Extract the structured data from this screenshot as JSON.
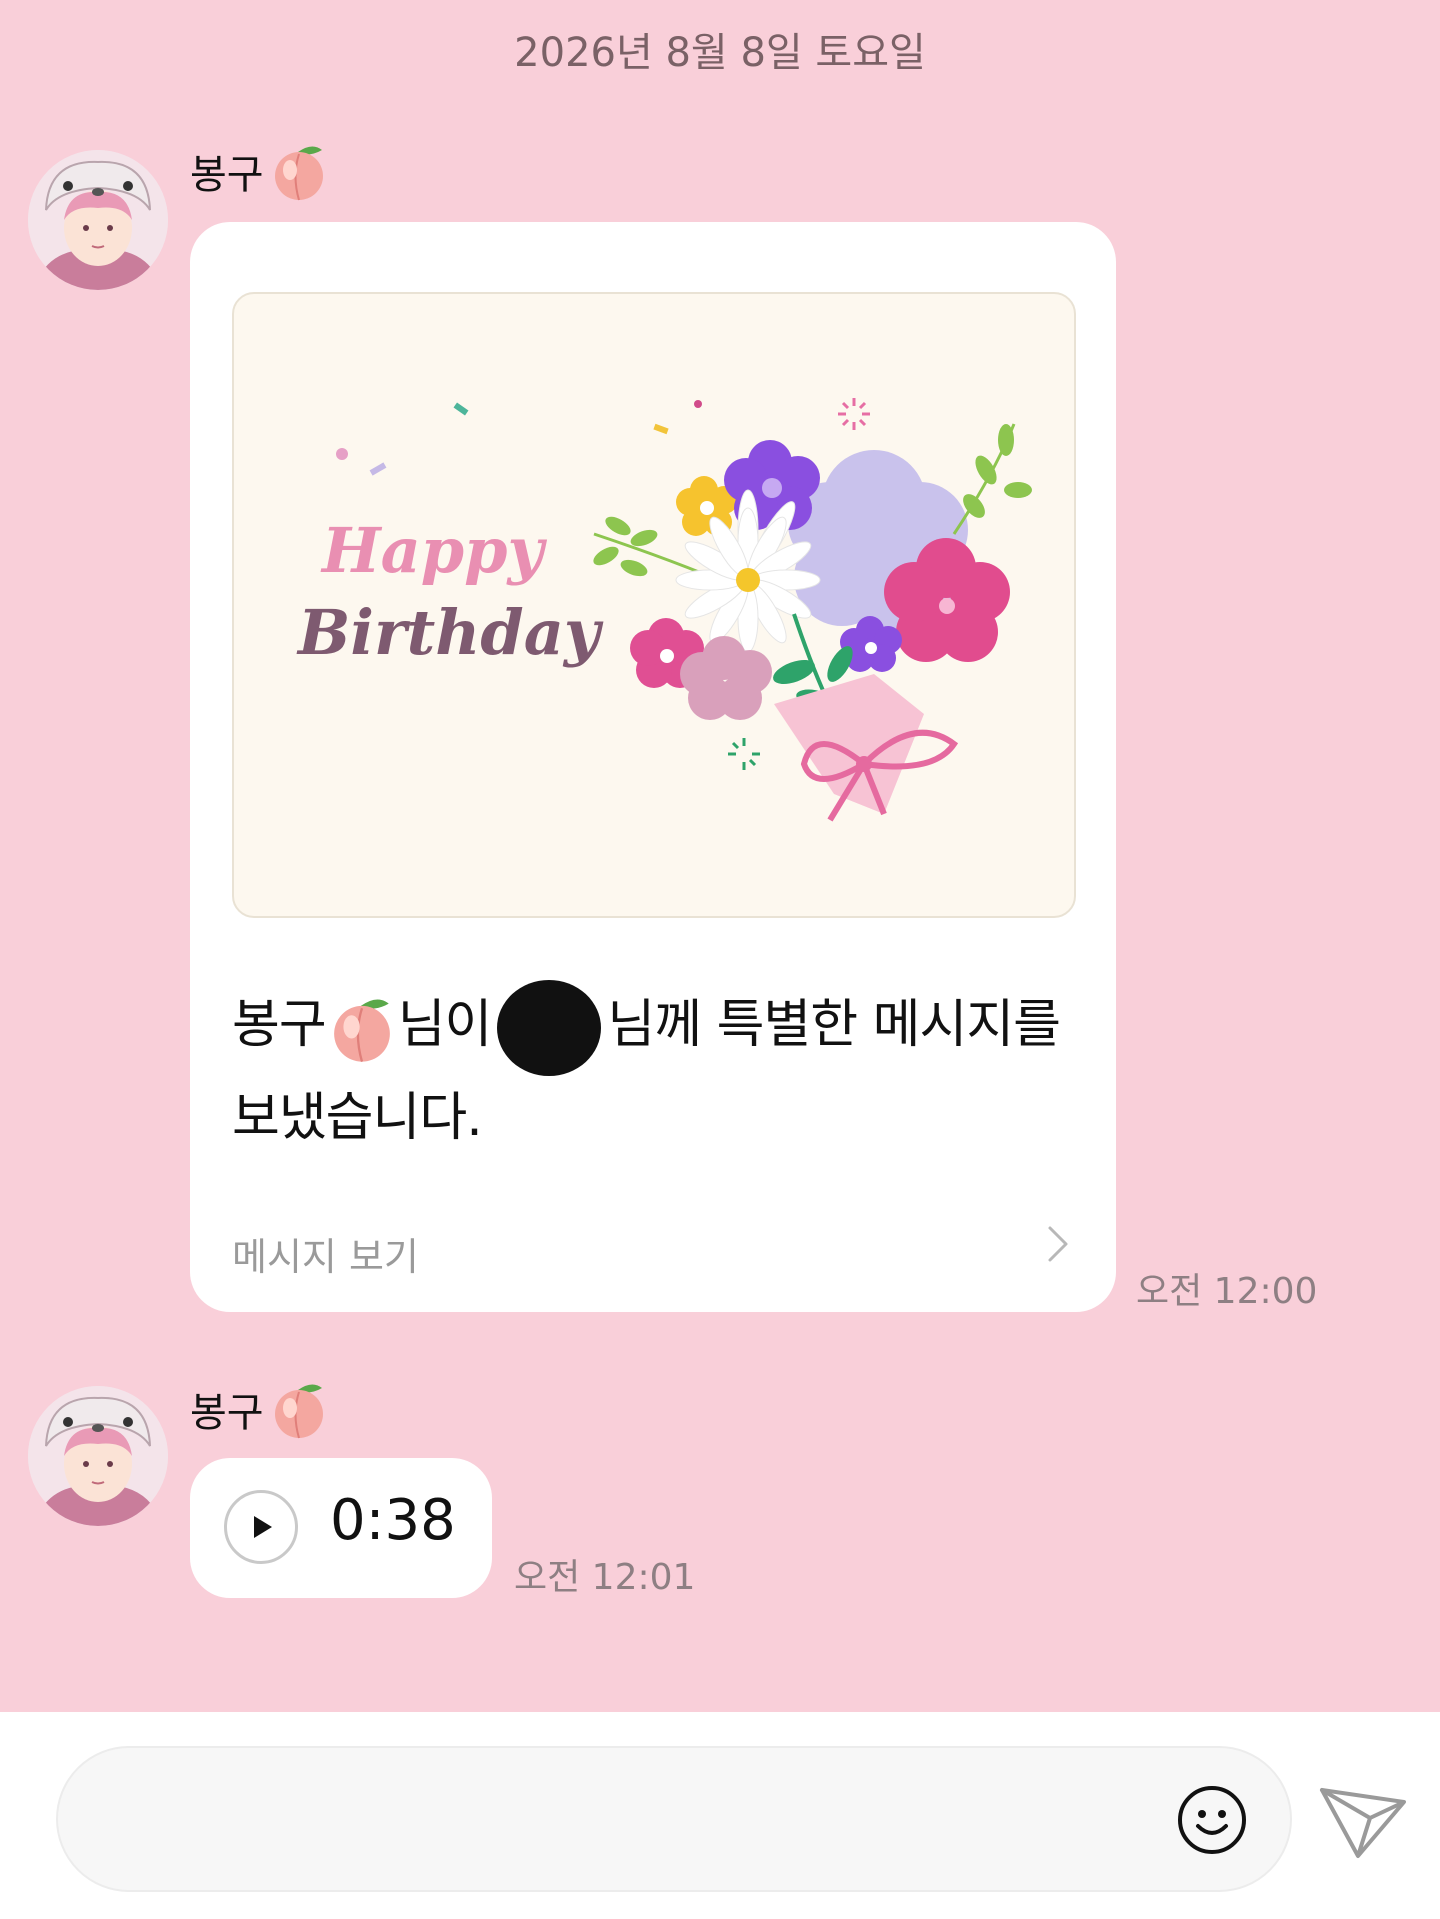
{
  "date_separator": "2026년 8월 8일 토요일",
  "messages": [
    {
      "sender": "봉구",
      "sender_emoji": "peach",
      "card": {
        "image_text_line1": "Happy",
        "image_text_line2": "Birthday",
        "body_part1": "봉구",
        "body_part2": "님이",
        "body_part3": "님께 특별한 메시지를 보냈습니다.",
        "link_label": "메시지 보기"
      },
      "time": "오전 12:00"
    },
    {
      "sender": "봉구",
      "sender_emoji": "peach",
      "voice_duration": "0:38",
      "time": "오전 12:01"
    }
  ],
  "input": {
    "placeholder": ""
  },
  "colors": {
    "background": "#f9cfd9",
    "bubble": "#ffffff",
    "happy": "#e98fb2",
    "birthday": "#7e5a70"
  },
  "icons": [
    "play-icon",
    "chevron-right-icon",
    "emoji-icon",
    "send-icon",
    "peach-icon"
  ]
}
